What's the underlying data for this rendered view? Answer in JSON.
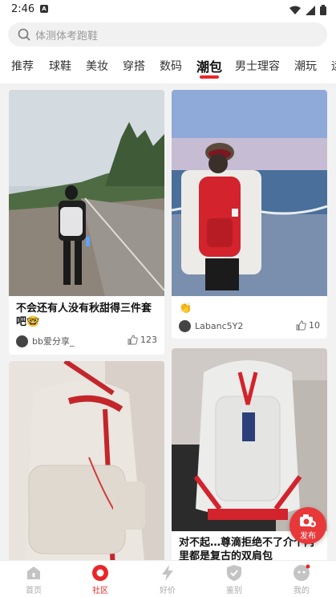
{
  "status": {
    "time": "2:46",
    "notification_badge": "A"
  },
  "search": {
    "placeholder": "体测体考跑鞋"
  },
  "tabs": [
    {
      "label": "推荐"
    },
    {
      "label": "球鞋"
    },
    {
      "label": "美妆"
    },
    {
      "label": "穿搭"
    },
    {
      "label": "数码"
    },
    {
      "label": "潮包",
      "active": true
    },
    {
      "label": "男士理容"
    },
    {
      "label": "潮玩"
    },
    {
      "label": "运"
    }
  ],
  "feed": {
    "cards": [
      {
        "title": "不会还有人没有秋甜得三件套吧🤓",
        "author": "bb爱分享_",
        "likes": "123"
      },
      {
        "title": "👏",
        "author": "Labanc5Y2",
        "likes": "10"
      },
      {
        "title": "",
        "author": "",
        "likes": ""
      },
      {
        "title": "对不起…尊滴拒绝不了介个内里都是复古的双肩包",
        "author": "",
        "likes": ""
      }
    ]
  },
  "fab": {
    "label": "发布"
  },
  "bottom_nav": [
    {
      "label": "首页",
      "icon": "home-icon"
    },
    {
      "label": "社区",
      "icon": "community-icon",
      "active": true
    },
    {
      "label": "好价",
      "icon": "lightning-icon"
    },
    {
      "label": "鉴别",
      "icon": "shield-check-icon"
    },
    {
      "label": "我的",
      "icon": "profile-icon"
    }
  ],
  "colors": {
    "accent": "#e8262a",
    "fab": "#e8383a"
  }
}
